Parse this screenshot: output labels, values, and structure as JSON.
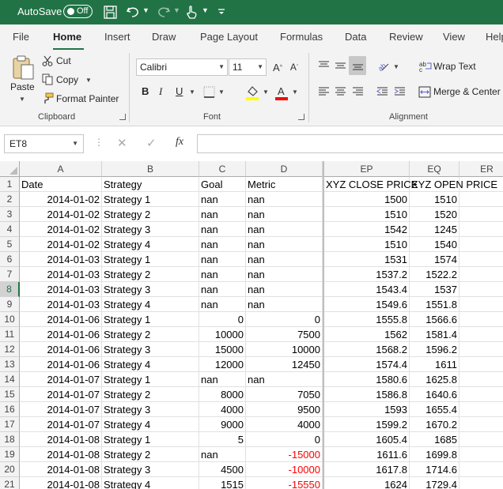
{
  "titlebar": {
    "autosave_label": "AutoSave",
    "autosave_state": "Off",
    "icons": [
      "save-icon",
      "undo-icon",
      "redo-icon",
      "touch-mode-icon",
      "customize-qat-icon"
    ]
  },
  "tabs": [
    "File",
    "Home",
    "Insert",
    "Draw",
    "Page Layout",
    "Formulas",
    "Data",
    "Review",
    "View",
    "Help"
  ],
  "active_tab": "Home",
  "clipboard": {
    "paste": "Paste",
    "cut": "Cut",
    "copy": "Copy",
    "format_painter": "Format Painter",
    "label": "Clipboard"
  },
  "font": {
    "name": "Calibri",
    "size": "11",
    "bold": "B",
    "italic": "I",
    "underline": "U",
    "label": "Font",
    "fill_color": "#ffff00",
    "font_color": "#ff0000"
  },
  "alignment": {
    "wrap_text": "Wrap Text",
    "merge_center": "Merge & Center",
    "label": "Alignment"
  },
  "formula_bar": {
    "name_box": "ET8",
    "fx": "fx",
    "value": ""
  },
  "grid": {
    "columns": [
      "A",
      "B",
      "C",
      "D",
      "EP",
      "EQ",
      "ER"
    ],
    "selected_row": 8,
    "rows": [
      {
        "n": "1",
        "a": "Date",
        "b": "Strategy",
        "c": "Goal",
        "d": "Metric",
        "ep": "XYZ CLOSE PRICE",
        "eq": "XYZ OPEN PRICE"
      },
      {
        "n": "2",
        "a": "2014-01-02",
        "b": "Strategy 1",
        "c": "nan",
        "d": "nan",
        "ep": "1500",
        "eq": "1510"
      },
      {
        "n": "3",
        "a": "2014-01-02",
        "b": "Strategy 2",
        "c": "nan",
        "d": "nan",
        "ep": "1510",
        "eq": "1520"
      },
      {
        "n": "4",
        "a": "2014-01-02",
        "b": "Strategy 3",
        "c": "nan",
        "d": "nan",
        "ep": "1542",
        "eq": "1245"
      },
      {
        "n": "5",
        "a": "2014-01-02",
        "b": "Strategy 4",
        "c": "nan",
        "d": "nan",
        "ep": "1510",
        "eq": "1540"
      },
      {
        "n": "6",
        "a": "2014-01-03",
        "b": "Strategy 1",
        "c": "nan",
        "d": "nan",
        "ep": "1531",
        "eq": "1574"
      },
      {
        "n": "7",
        "a": "2014-01-03",
        "b": "Strategy 2",
        "c": "nan",
        "d": "nan",
        "ep": "1537.2",
        "eq": "1522.2"
      },
      {
        "n": "8",
        "a": "2014-01-03",
        "b": "Strategy 3",
        "c": "nan",
        "d": "nan",
        "ep": "1543.4",
        "eq": "1537"
      },
      {
        "n": "9",
        "a": "2014-01-03",
        "b": "Strategy 4",
        "c": "nan",
        "d": "nan",
        "ep": "1549.6",
        "eq": "1551.8"
      },
      {
        "n": "10",
        "a": "2014-01-06",
        "b": "Strategy 1",
        "c": "0",
        "d": "0",
        "ep": "1555.8",
        "eq": "1566.6"
      },
      {
        "n": "11",
        "a": "2014-01-06",
        "b": "Strategy 2",
        "c": "10000",
        "d": "7500",
        "ep": "1562",
        "eq": "1581.4"
      },
      {
        "n": "12",
        "a": "2014-01-06",
        "b": "Strategy 3",
        "c": "15000",
        "d": "10000",
        "ep": "1568.2",
        "eq": "1596.2"
      },
      {
        "n": "13",
        "a": "2014-01-06",
        "b": "Strategy 4",
        "c": "12000",
        "d": "12450",
        "ep": "1574.4",
        "eq": "1611"
      },
      {
        "n": "14",
        "a": "2014-01-07",
        "b": "Strategy 1",
        "c": "nan",
        "d": "nan",
        "ep": "1580.6",
        "eq": "1625.8"
      },
      {
        "n": "15",
        "a": "2014-01-07",
        "b": "Strategy 2",
        "c": "8000",
        "d": "7050",
        "ep": "1586.8",
        "eq": "1640.6"
      },
      {
        "n": "16",
        "a": "2014-01-07",
        "b": "Strategy 3",
        "c": "4000",
        "d": "9500",
        "ep": "1593",
        "eq": "1655.4"
      },
      {
        "n": "17",
        "a": "2014-01-07",
        "b": "Strategy 4",
        "c": "9000",
        "d": "4000",
        "ep": "1599.2",
        "eq": "1670.2"
      },
      {
        "n": "18",
        "a": "2014-01-08",
        "b": "Strategy 1",
        "c": "5",
        "d": "0",
        "ep": "1605.4",
        "eq": "1685"
      },
      {
        "n": "19",
        "a": "2014-01-08",
        "b": "Strategy 2",
        "c": "nan",
        "d": "-15000",
        "ep": "1611.6",
        "eq": "1699.8"
      },
      {
        "n": "20",
        "a": "2014-01-08",
        "b": "Strategy 3",
        "c": "4500",
        "d": "-10000",
        "ep": "1617.8",
        "eq": "1714.6"
      },
      {
        "n": "21",
        "a": "2014-01-08",
        "b": "Strategy 4",
        "c": "1515",
        "d": "-15550",
        "ep": "1624",
        "eq": "1729.4"
      }
    ]
  }
}
